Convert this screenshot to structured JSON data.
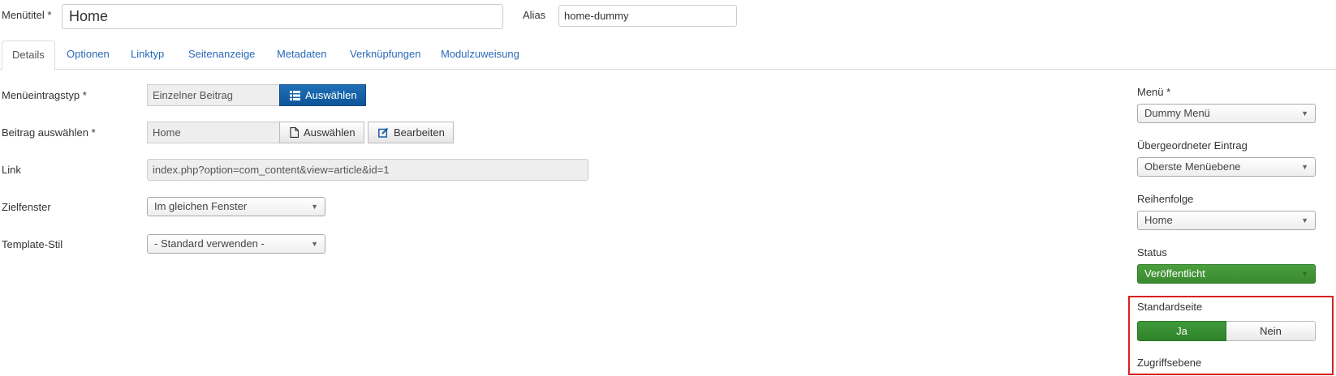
{
  "header": {
    "title_label": "Menütitel *",
    "title_value": "Home",
    "alias_label": "Alias",
    "alias_value": "home-dummy"
  },
  "tabs": [
    {
      "label": "Details",
      "active": true
    },
    {
      "label": "Optionen"
    },
    {
      "label": "Linktyp"
    },
    {
      "label": "Seitenanzeige"
    },
    {
      "label": "Metadaten"
    },
    {
      "label": "Verknüpfungen"
    },
    {
      "label": "Modulzuweisung"
    }
  ],
  "form": {
    "menu_item_type": {
      "label": "Menüeintragstyp *",
      "value": "Einzelner Beitrag",
      "button": "Auswählen",
      "icon": "list-icon"
    },
    "article": {
      "label": "Beitrag auswählen *",
      "value": "Home",
      "select_button": "Auswählen",
      "select_icon": "file-icon",
      "edit_button": "Bearbeiten",
      "edit_icon": "edit-icon"
    },
    "link": {
      "label": "Link",
      "value": "index.php?option=com_content&view=article&id=1"
    },
    "target_window": {
      "label": "Zielfenster",
      "value": "Im gleichen Fenster"
    },
    "template_style": {
      "label": "Template-Stil",
      "value": "- Standard verwenden -"
    }
  },
  "sidebar": {
    "menu": {
      "label": "Menü *",
      "value": "Dummy Menü"
    },
    "parent": {
      "label": "Übergeordneter Eintrag",
      "value": "Oberste Menüebene"
    },
    "ordering": {
      "label": "Reihenfolge",
      "value": "Home"
    },
    "status": {
      "label": "Status",
      "value": "Veröffentlicht",
      "color": "#3f9a3a"
    },
    "default_page": {
      "label": "Standardseite",
      "yes": "Ja",
      "no": "Nein",
      "selected": "Ja",
      "highlight_color": "#d9201e"
    },
    "access": {
      "label": "Zugriffsebene"
    }
  }
}
